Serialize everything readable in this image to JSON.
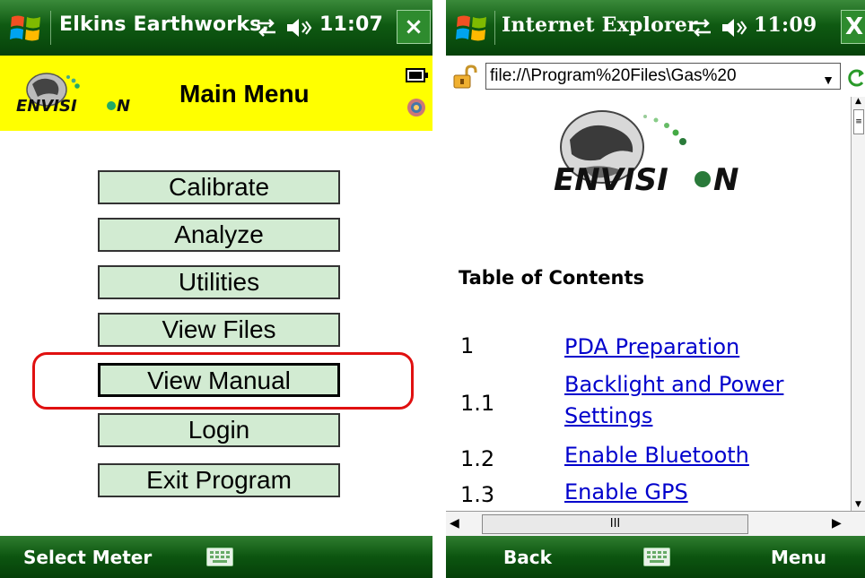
{
  "left": {
    "title": "Elkins Earthworks,",
    "time": "11:07",
    "close": "×",
    "header_title": "Main Menu",
    "logo_text": "ENVISI·N",
    "menu": [
      "Calibrate",
      "Analyze",
      "Utilities",
      "View Files",
      "View Manual",
      "Login",
      "Exit Program"
    ],
    "softkey_left": "Select Meter"
  },
  "right": {
    "title": "Internet Explorer",
    "time": "11:09",
    "close": "X",
    "address": "file://\\Program%20Files\\Gas%20",
    "logo_text": "ENVISI·N",
    "toc_title": "Table of Contents",
    "toc": [
      {
        "num": "1",
        "label": "PDA Preparation"
      },
      {
        "num": "1.1",
        "label": "Backlight and Power Settings"
      },
      {
        "num": "1.2",
        "label": "Enable Bluetooth"
      },
      {
        "num": "1.3",
        "label": "Enable GPS"
      }
    ],
    "hscroll_grip": "III",
    "softkey_left": "Back",
    "softkey_right": "Menu"
  }
}
